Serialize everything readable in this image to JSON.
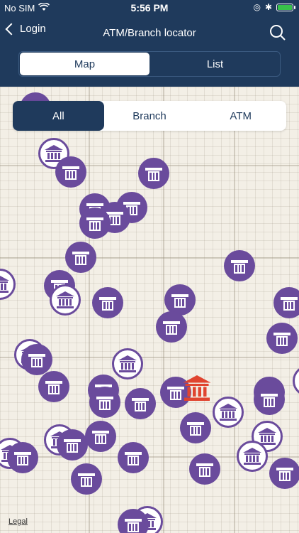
{
  "status": {
    "carrier": "No SIM",
    "time": "5:56 PM"
  },
  "navbar": {
    "back_label": "Login",
    "title": "ATM/Branch locator"
  },
  "view_toggle": [
    {
      "label": "Map",
      "active": true
    },
    {
      "label": "List",
      "active": false
    }
  ],
  "filter": [
    {
      "label": "All",
      "active": true
    },
    {
      "label": "Branch",
      "active": false
    },
    {
      "label": "ATM",
      "active": false
    }
  ],
  "map": {
    "legal_label": "Legal"
  },
  "icons": {
    "atm": "atm-card-icon",
    "branch": "bank-building-icon",
    "current": "bank-building-icon"
  },
  "colors": {
    "header": "#1f3a5c",
    "pin": "#6a4b9c",
    "current": "#e0442f"
  }
}
